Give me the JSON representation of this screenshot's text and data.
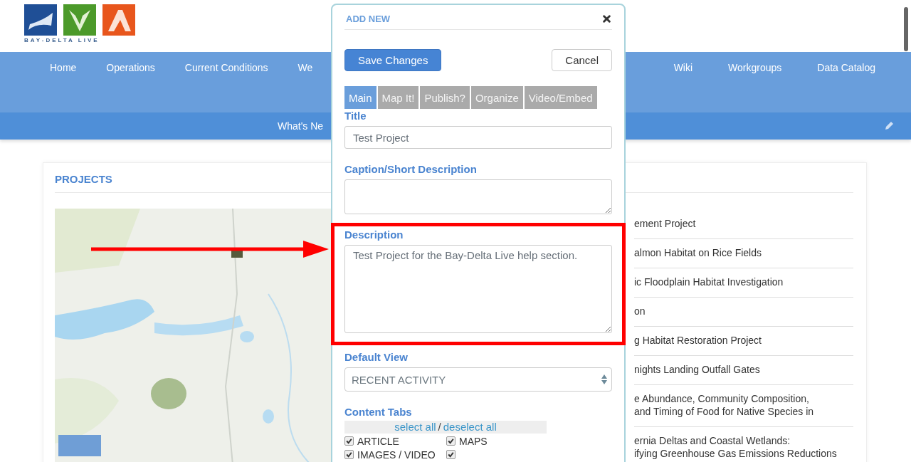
{
  "header": {
    "logo_text": "BAY-DELTA LIVE"
  },
  "nav": {
    "left": [
      "Home",
      "Operations",
      "Current Conditions",
      "We"
    ],
    "right": [
      "Wiki",
      "Workgroups",
      "Data Catalog"
    ]
  },
  "subnav": {
    "label": "What's Ne"
  },
  "projects": {
    "title": "PROJECTS",
    "map": {
      "kind": "picture"
    },
    "items": [
      [
        "ement Project"
      ],
      [
        "almon Habitat on Rice Fields"
      ],
      [
        "ic Floodplain Habitat Investigation"
      ],
      [
        "on"
      ],
      [
        "g Habitat Restoration Project"
      ],
      [
        "nights Landing Outfall Gates"
      ],
      [
        "e Abundance, Community Composition,",
        "and Timing of Food for Native Species in"
      ],
      [
        "ernia Deltas and Coastal Wetlands:",
        "ifying Greenhouse Gas Emissions Reductions"
      ]
    ]
  },
  "dialog": {
    "title": "ADD NEW",
    "buttons": [
      {
        "label": "Save Changes",
        "kind": "primary"
      },
      {
        "label": "Cancel",
        "kind": "default"
      }
    ],
    "tabs": [
      {
        "label": "Main",
        "selected": true
      },
      {
        "label": "Map It!",
        "selected": false
      },
      {
        "label": "Publish?",
        "selected": false
      },
      {
        "label": "Organize",
        "selected": false
      },
      {
        "label": "Video/Embed",
        "selected": false
      }
    ],
    "title_field": {
      "label": "Title",
      "value": "Test Project"
    },
    "caption_field": {
      "label": "Caption/Short Description"
    },
    "description_field": {
      "label": "Description",
      "value": "Test Project for the Bay-Delta Live help section."
    },
    "default_view": {
      "label": "Default View",
      "value": "RECENT ACTIVITY"
    },
    "content_tabs": {
      "label": "Content Tabs",
      "select_all": "select all",
      "separator": "/",
      "deselect_all": "deselect all",
      "options": [
        {
          "label": "ARTICLE",
          "checked": true
        },
        {
          "label": "MAPS",
          "checked": true
        },
        {
          "label": "IMAGES / VIDEO",
          "checked": true
        },
        {
          "checked": true
        }
      ]
    }
  }
}
